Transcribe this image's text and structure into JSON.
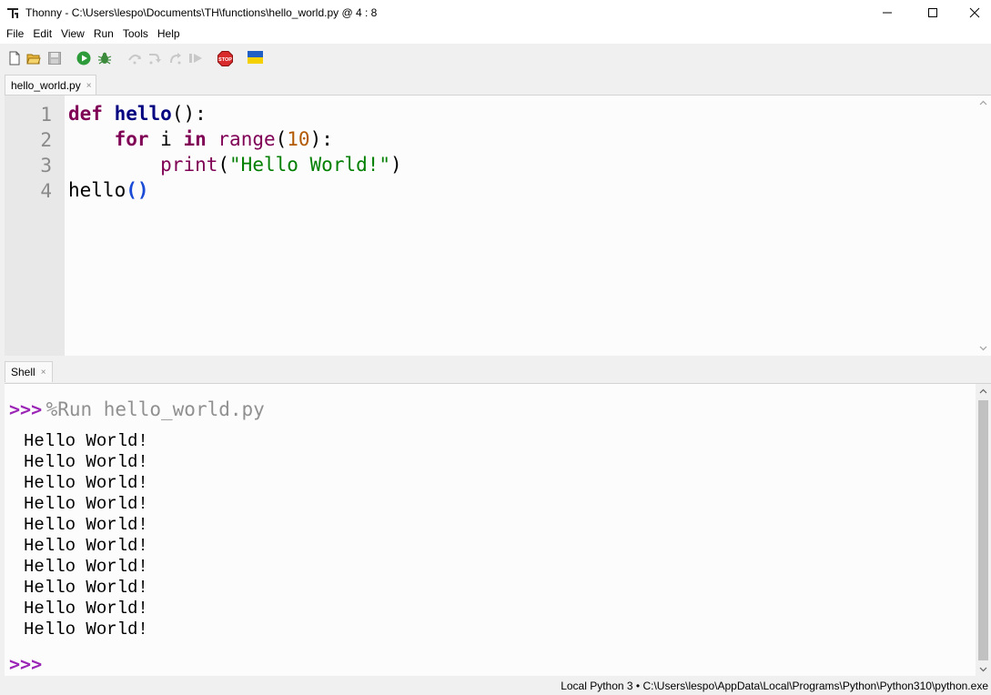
{
  "window": {
    "app_name": "Thonny",
    "title": "Thonny  -  C:\\Users\\lespo\\Documents\\TH\\functions\\hello_world.py  @  4 : 8"
  },
  "menu": [
    "File",
    "Edit",
    "View",
    "Run",
    "Tools",
    "Help"
  ],
  "toolbar_icons": [
    "new-file-icon",
    "open-file-icon",
    "save-icon",
    "run-icon",
    "debug-icon",
    "step-over-icon",
    "step-into-icon",
    "step-out-icon",
    "resume-icon",
    "stop-icon",
    "ukraine-flag-icon"
  ],
  "editor": {
    "tab_label": "hello_world.py",
    "tab_close": "×",
    "line_numbers": [
      "1",
      "2",
      "3",
      "4"
    ]
  },
  "code": {
    "l1": {
      "kw": "def",
      "name": "hello",
      "rest": "():"
    },
    "l2": {
      "indent": "    ",
      "kw1": "for",
      "var": " i ",
      "kw2": "in",
      "sp": " ",
      "builtin": "range",
      "open": "(",
      "num": "10",
      "close": "):"
    },
    "l3": {
      "indent": "        ",
      "builtin": "print",
      "open": "(",
      "str": "\"Hello World!\"",
      "close": ")"
    },
    "l4": {
      "name": "hello",
      "parens": "()"
    }
  },
  "shell": {
    "tab_label": "Shell",
    "tab_close": "×",
    "prompt": ">>>",
    "command": "%Run hello_world.py",
    "output": [
      "Hello World!",
      "Hello World!",
      "Hello World!",
      "Hello World!",
      "Hello World!",
      "Hello World!",
      "Hello World!",
      "Hello World!",
      "Hello World!",
      "Hello World!"
    ],
    "final_prompt": ">>>"
  },
  "status": {
    "text": "Local Python 3  •  C:\\Users\\lespo\\AppData\\Local\\Programs\\Python\\Python310\\python.exe"
  },
  "colors": {
    "keyword": "#7f0055",
    "function_name": "#000080",
    "number": "#b35a00",
    "string": "#007f00",
    "prompt": "#9b26b6",
    "gutter": "#e8e8e8"
  }
}
